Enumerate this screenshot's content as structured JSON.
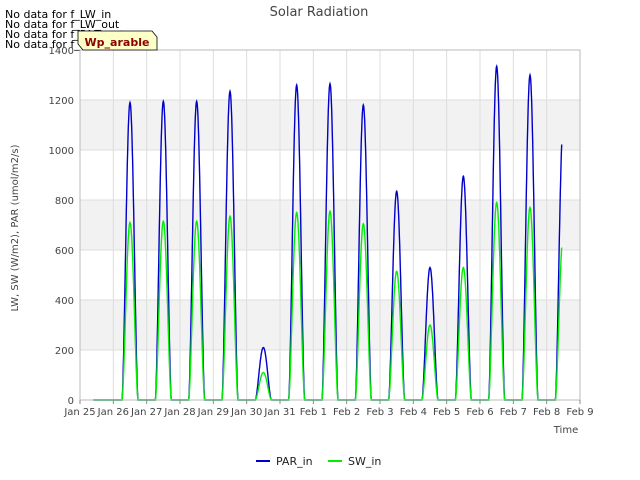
{
  "no_data_notes": [
    "No data for f_LW_in",
    "No data for f_LW_out",
    "No data for f_PAR_out",
    "No data for f_SW_out"
  ],
  "badge": {
    "text": "Wp_arable",
    "color": "#8b0000",
    "background": "#ffffc8"
  },
  "chart_data": {
    "type": "line",
    "title": "Solar Radiation",
    "xlabel": "Time",
    "ylabel": "LW, SW (W/m2), PAR (umol/m2/s)",
    "ylim": [
      0,
      1400
    ],
    "yticks": [
      0,
      200,
      400,
      600,
      800,
      1000,
      1200,
      1400
    ],
    "xticks": [
      "Jan 25",
      "Jan 26",
      "Jan 27",
      "Jan 28",
      "Jan 29",
      "Jan 30",
      "Jan 31",
      "Feb 1",
      "Feb 2",
      "Feb 3",
      "Feb 4",
      "Feb 5",
      "Feb 6",
      "Feb 7",
      "Feb 8",
      "Feb 9"
    ],
    "x_range_days": [
      0,
      15
    ],
    "data_span_days": [
      0.4,
      14.45
    ],
    "grid": true,
    "banded_background": true,
    "legend_position": "bottom-center",
    "series": [
      {
        "name": "PAR_in",
        "color": "#0000cc",
        "daily_peaks": [
          {
            "day": "Jan 26",
            "peak": 1190
          },
          {
            "day": "Jan 27",
            "peak": 1195
          },
          {
            "day": "Jan 28",
            "peak": 1195
          },
          {
            "day": "Jan 29",
            "peak": 1235
          },
          {
            "day": "Jan 30",
            "peak": 210
          },
          {
            "day": "Jan 31",
            "peak": 1260
          },
          {
            "day": "Feb 1",
            "peak": 1265
          },
          {
            "day": "Feb 2",
            "peak": 1180
          },
          {
            "day": "Feb 3",
            "peak": 835
          },
          {
            "day": "Feb 4",
            "peak": 530
          },
          {
            "day": "Feb 5",
            "peak": 895
          },
          {
            "day": "Feb 6",
            "peak": 1335
          },
          {
            "day": "Feb 7",
            "peak": 1300
          },
          {
            "day": "Feb 8",
            "peak": 1115
          }
        ]
      },
      {
        "name": "SW_in",
        "color": "#00ee00",
        "daily_peaks": [
          {
            "day": "Jan 26",
            "peak": 710
          },
          {
            "day": "Jan 27",
            "peak": 715
          },
          {
            "day": "Jan 28",
            "peak": 715
          },
          {
            "day": "Jan 29",
            "peak": 735
          },
          {
            "day": "Jan 30",
            "peak": 110
          },
          {
            "day": "Jan 31",
            "peak": 750
          },
          {
            "day": "Feb 1",
            "peak": 755
          },
          {
            "day": "Feb 2",
            "peak": 705
          },
          {
            "day": "Feb 3",
            "peak": 515
          },
          {
            "day": "Feb 4",
            "peak": 300
          },
          {
            "day": "Feb 5",
            "peak": 530
          },
          {
            "day": "Feb 6",
            "peak": 790
          },
          {
            "day": "Feb 7",
            "peak": 770
          },
          {
            "day": "Feb 8",
            "peak": 665
          }
        ]
      }
    ]
  }
}
